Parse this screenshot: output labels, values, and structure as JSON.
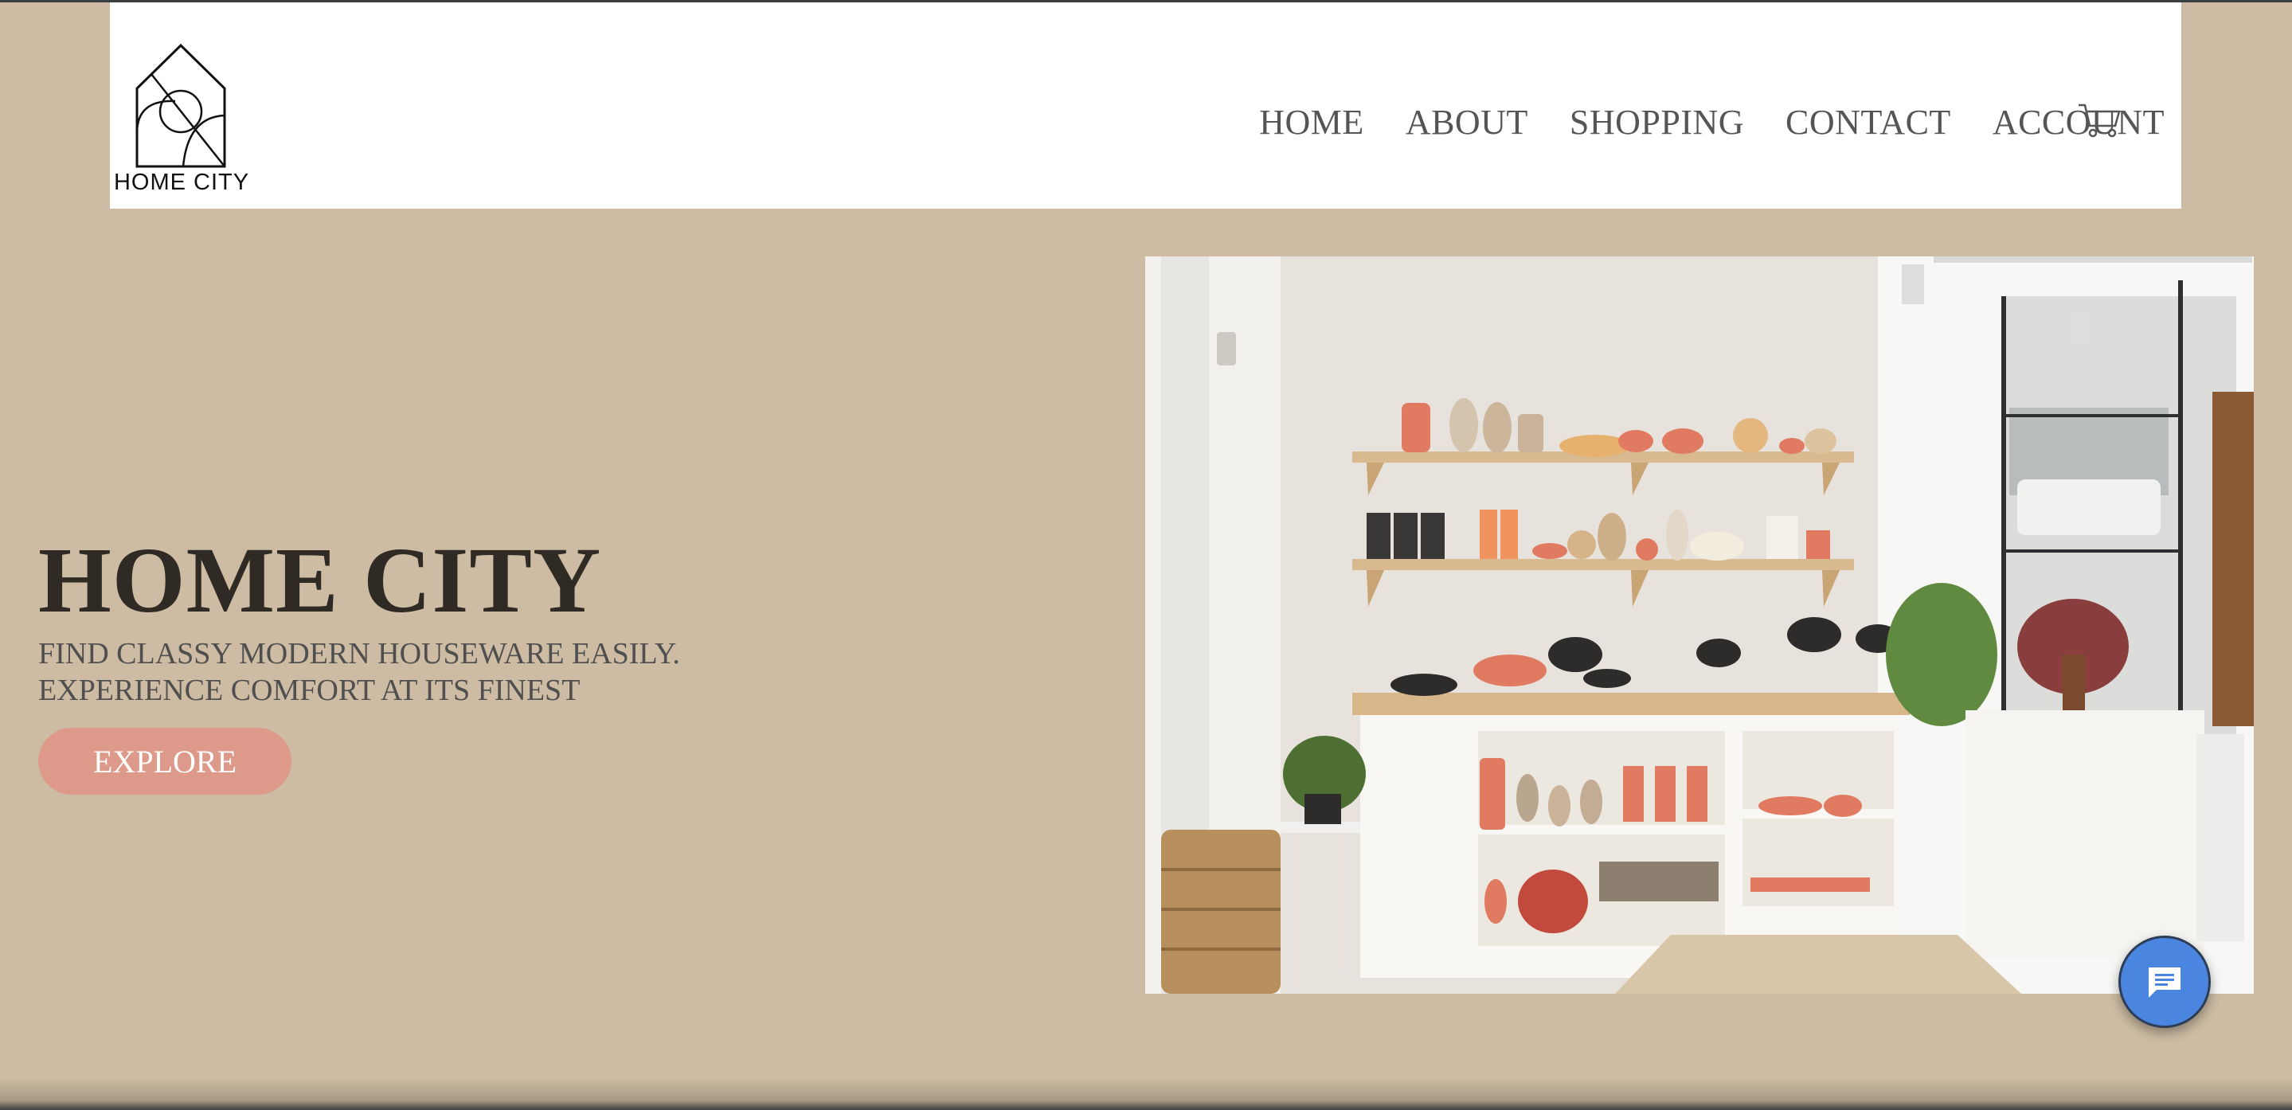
{
  "header": {
    "logo_text": "HOME CITY",
    "nav": [
      {
        "label": "HOME"
      },
      {
        "label": "ABOUT"
      },
      {
        "label": "SHOPPING"
      },
      {
        "label": "CONTACT"
      },
      {
        "label": "ACCOUNT"
      }
    ],
    "cart_icon": "cart-icon"
  },
  "hero": {
    "title": "HOME CITY",
    "subtitle_line1": "FIND CLASSY MODERN HOUSEWARE EASILY.",
    "subtitle_line2": "EXPERIENCE COMFORT AT ITS FINEST",
    "button_label": "EXPLORE"
  },
  "chat": {
    "icon": "chat-icon"
  },
  "colors": {
    "background": "#cdbca3",
    "header_bg": "#ffffff",
    "accent": "#dd9a8a",
    "chat": "#4a86e0"
  }
}
